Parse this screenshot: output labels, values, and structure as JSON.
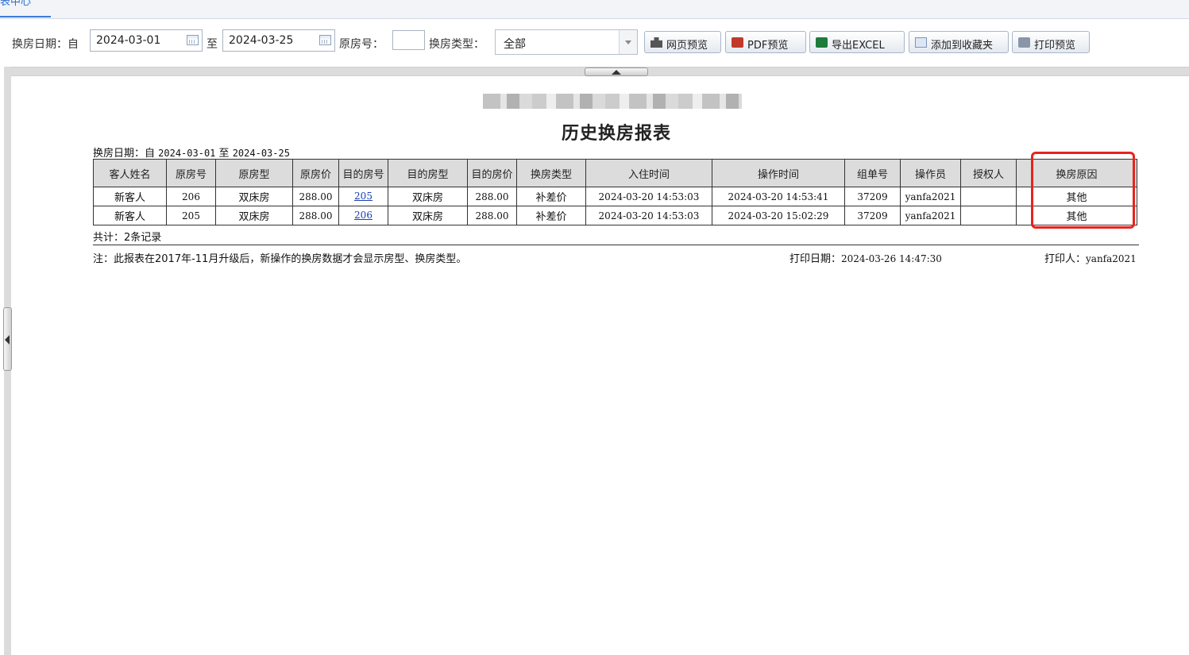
{
  "tab": {
    "label": "表中心"
  },
  "filters": {
    "date_label": "换房日期：自",
    "from_date": "2024-03-01",
    "to_label": "至",
    "to_date": "2024-03-25",
    "room_label": "原房号：",
    "room_value": "",
    "type_label": "换房类型：",
    "type_value": "全部"
  },
  "buttons": {
    "web_preview": "网页预览",
    "pdf_preview": "PDF预览",
    "export_excel": "导出EXCEL",
    "add_favorites": "添加到收藏夹",
    "print_preview": "打印预览"
  },
  "report": {
    "title": "历史换房报表",
    "date_range_label": "换房日期：自",
    "date_from": "2024-03-01",
    "date_to_label": "至",
    "date_to": "2024-03-25",
    "columns": [
      "客人姓名",
      "原房号",
      "原房型",
      "原房价",
      "目的房号",
      "目的房型",
      "目的房价",
      "换房类型",
      "入住时间",
      "操作时间",
      "组单号",
      "操作员",
      "授权人",
      "换房原因"
    ],
    "rows": [
      [
        "新客人",
        "206",
        "双床房",
        "288.00",
        "205",
        "双床房",
        "288.00",
        "补差价",
        "2024-03-20 14:53:03",
        "2024-03-20 14:53:41",
        "37209",
        "yanfa2021",
        "",
        "其他"
      ],
      [
        "新客人",
        "205",
        "双床房",
        "288.00",
        "206",
        "双床房",
        "288.00",
        "补差价",
        "2024-03-20 14:53:03",
        "2024-03-20 15:02:29",
        "37209",
        "yanfa2021",
        "",
        "其他"
      ]
    ],
    "total": "共计：2条记录",
    "note": "注：此报表在2017年-11月升级后，新操作的换房数据才会显示房型、换房类型。",
    "print_date_label": "打印日期：",
    "print_date": "2024-03-26 14:47:30",
    "printer_label": "打印人：",
    "printer": "yanfa2021"
  },
  "colors": {
    "highlight": "#e8231e",
    "link": "#1a3fb3",
    "header_bg": "#dcdcdc"
  }
}
